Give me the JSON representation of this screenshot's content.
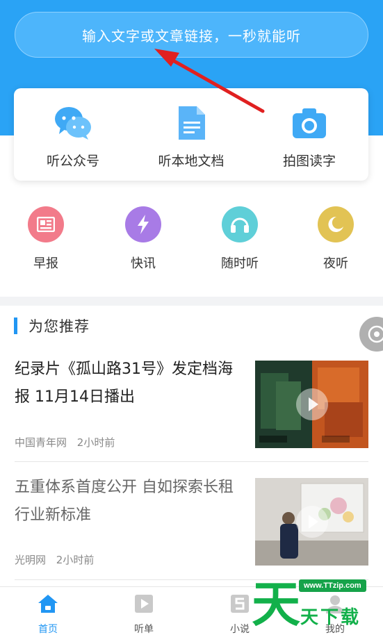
{
  "search": {
    "placeholder": "输入文字或文章链接，一秒就能听"
  },
  "card_actions": [
    {
      "label": "听公众号",
      "icon": "wechat-icon"
    },
    {
      "label": "听本地文档",
      "icon": "document-icon"
    },
    {
      "label": "拍图读字",
      "icon": "camera-icon"
    }
  ],
  "quick_actions": [
    {
      "label": "早报",
      "icon": "newspaper-icon",
      "color": "#f27b8a"
    },
    {
      "label": "快讯",
      "icon": "lightning-icon",
      "color": "#a87be6"
    },
    {
      "label": "随时听",
      "icon": "headphones-icon",
      "color": "#5fcfd8"
    },
    {
      "label": "夜听",
      "icon": "moon-icon",
      "color": "#e2c354"
    }
  ],
  "recommend": {
    "section_title": "为您推荐",
    "articles": [
      {
        "title": "纪录片《孤山路31号》发定档海报 11月14日播出",
        "source": "中国青年网",
        "time": "2小时前",
        "has_video": true
      },
      {
        "title": "五重体系首度公开 自如探索长租行业新标准",
        "source": "光明网",
        "time": "2小时前",
        "has_video": true
      }
    ]
  },
  "tabs": [
    {
      "label": "首页",
      "icon": "home-icon",
      "active": true
    },
    {
      "label": "听单",
      "icon": "play-list-icon",
      "active": false
    },
    {
      "label": "小说",
      "icon": "novel-icon",
      "active": false
    },
    {
      "label": "我的",
      "icon": "profile-icon",
      "active": false
    }
  ],
  "watermark": {
    "url": "www.TTzip.com",
    "text": "天下载",
    "big_char": "天"
  },
  "colors": {
    "primary": "#2aa3f5",
    "accent_blue": "#2196f3",
    "arrow": "#e02020"
  }
}
